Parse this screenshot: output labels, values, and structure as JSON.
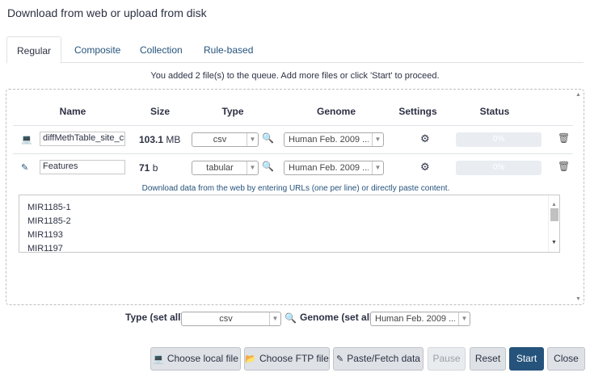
{
  "dialog": {
    "title": "Download from web or upload from disk"
  },
  "tabs": [
    {
      "label": "Regular",
      "active": true
    },
    {
      "label": "Composite",
      "active": false
    },
    {
      "label": "Collection",
      "active": false
    },
    {
      "label": "Rule-based",
      "active": false
    }
  ],
  "queue_info": "You added 2 file(s) to the queue. Add more files or click 'Start' to proceed.",
  "table": {
    "headers": {
      "name": "Name",
      "size": "Size",
      "type": "Type",
      "genome": "Genome",
      "settings": "Settings",
      "status": "Status"
    },
    "rows": [
      {
        "icon": "laptop-icon",
        "name": "diffMethTable_site_cmp",
        "size_value": "103.1",
        "size_unit": "MB",
        "type": "csv",
        "genome": "Human Feb. 2009 ...",
        "progress": "0%"
      },
      {
        "icon": "edit-icon",
        "name": "Features",
        "size_value": "71",
        "size_unit": "b",
        "type": "tabular",
        "genome": "Human Feb. 2009 ...",
        "progress": "0%"
      }
    ]
  },
  "paste": {
    "hint": "Download data from the web by entering URLs (one per line) or directly paste content.",
    "lines": [
      "MIR1185-1",
      "MIR1185-2",
      "MIR1193",
      "MIR1197"
    ]
  },
  "set_all": {
    "type_label": "Type (set all):",
    "type_value": "csv",
    "genome_label": "Genome (set all):",
    "genome_value": "Human Feb. 2009 ..."
  },
  "buttons": {
    "choose_local": "Choose local file",
    "choose_ftp": "Choose FTP file",
    "paste_fetch": "Paste/Fetch data",
    "pause": "Pause",
    "reset": "Reset",
    "start": "Start",
    "close": "Close"
  },
  "colors": {
    "primary": "#25537b",
    "button_bg": "#dee2e6",
    "text": "#2c3143"
  }
}
